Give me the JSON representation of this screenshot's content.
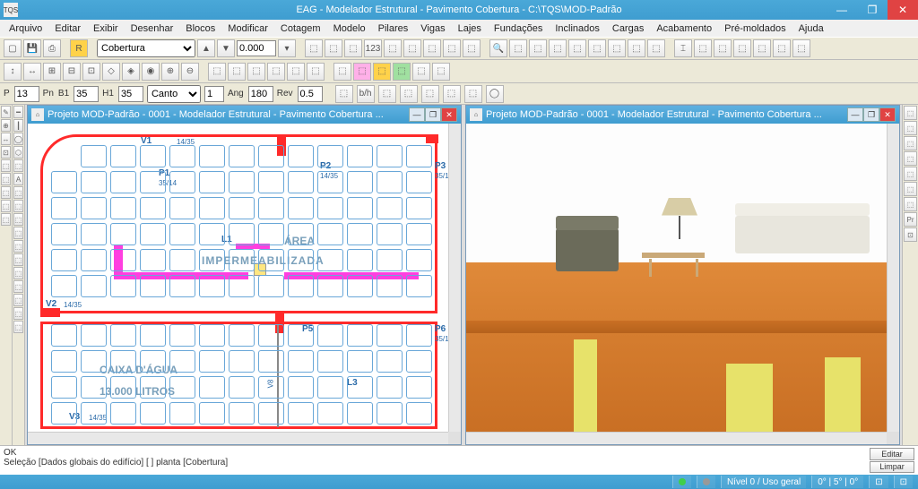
{
  "app": {
    "icon_label": "TQS",
    "title": "EAG - Modelador Estrutural - Pavimento Cobertura - C:\\TQS\\MOD-Padrão"
  },
  "menu": {
    "items": [
      "Arquivo",
      "Editar",
      "Exibir",
      "Desenhar",
      "Blocos",
      "Modificar",
      "Cotagem",
      "Modelo",
      "Pilares",
      "Vigas",
      "Lajes",
      "Fundações",
      "Inclinados",
      "Cargas",
      "Acabamento",
      "Pré-moldados",
      "Ajuda"
    ]
  },
  "toolbar_floor": {
    "selected": "Cobertura",
    "zoom_value": "0.000"
  },
  "props": {
    "p_label": "P",
    "p_value": "13",
    "pn_label": "Pn",
    "b1_label": "B1",
    "b1_value": "35",
    "h1_label": "H1",
    "h1_value": "35",
    "shape_label": "Canto",
    "shape_n": "1",
    "ang_label": "Ang",
    "ang_value": "180",
    "rev_label": "Rev",
    "rev_value": "0.5"
  },
  "pane_left": {
    "title": "Projeto MOD-Padrão - 0001 - Modelador Estrutural - Pavimento Cobertura ...",
    "labels": {
      "v1": "V1",
      "v1dim": "14/35",
      "p1": "P1",
      "p1dim": "35/14",
      "p2": "P2",
      "p2dim": "14/35",
      "p3": "P3",
      "p3dim": "35/1",
      "v2": "V2",
      "v2dim": "14/35",
      "p5": "P5",
      "p6": "P6",
      "p6dim": "35/1",
      "l1": "L1",
      "l3": "L3",
      "v3": "V3",
      "v3dim": "14/35",
      "v8": "V8",
      "area": "ÁREA",
      "imperm": "IMPERMEABILIZADA",
      "caixa": "CAIXA D'ÁGUA",
      "litros": "13.000 LITROS"
    }
  },
  "pane_right": {
    "title": "Projeto MOD-Padrão - 0001 - Modelador Estrutural - Pavimento Cobertura ..."
  },
  "right_rail": {
    "pr_label": "Pr"
  },
  "log": {
    "line1": "OK",
    "line2": "Seleção [Dados globais do edifício] [ ]  planta [Cobertura]",
    "edit_btn": "Editar",
    "clear_btn": "Limpar"
  },
  "status": {
    "level": "Nível 0 / Uso geral",
    "angles": "0° | 5° | 0°"
  }
}
